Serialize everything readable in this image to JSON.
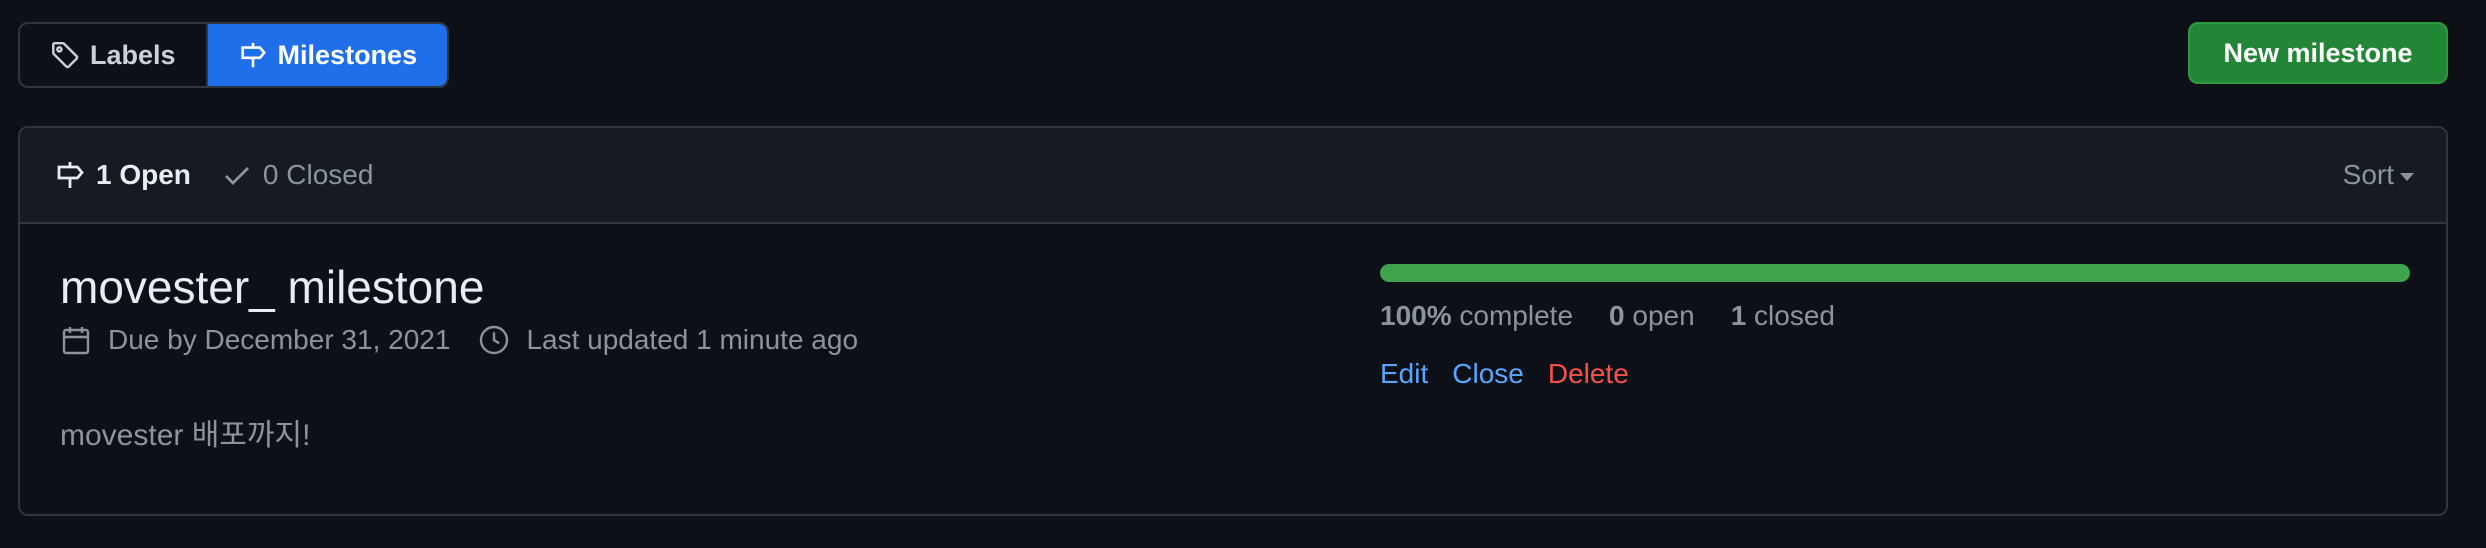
{
  "subnav": {
    "labels": {
      "label": "Labels",
      "icon": "tag-icon"
    },
    "milestones": {
      "label": "Milestones",
      "icon": "milestone-icon",
      "selected": true
    }
  },
  "new_milestone_button": "New milestone",
  "header": {
    "open_label": "1 Open",
    "closed_label": "0 Closed",
    "sort_label": "Sort"
  },
  "milestone": {
    "title": "movester_ milestone",
    "due": "Due by December 31, 2021",
    "updated": "Last updated 1 minute ago",
    "description": "movester 배포까지!",
    "progress_percent": 100,
    "percent_text": "100%",
    "complete_label": "complete",
    "open_count": "0",
    "open_label": "open",
    "closed_count": "1",
    "closed_label": "closed",
    "actions": {
      "edit": "Edit",
      "close": "Close",
      "delete": "Delete"
    }
  },
  "colors": {
    "background": "#0d1117",
    "accent_blue": "#1f6feb",
    "primary_green": "#238636",
    "progress_green": "#3fa34d",
    "danger_red": "#f85149",
    "link_blue": "#58a6ff"
  }
}
